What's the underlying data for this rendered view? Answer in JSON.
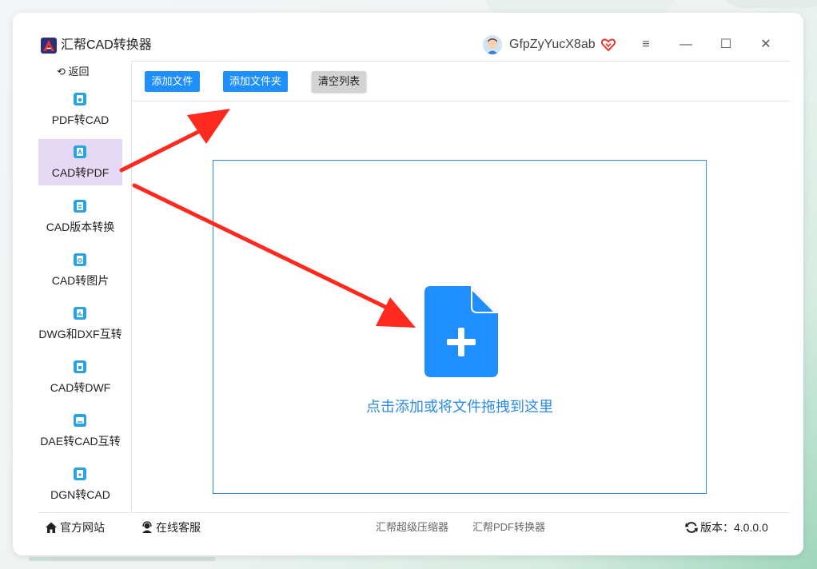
{
  "app": {
    "title": "汇帮CAD转换器"
  },
  "user": {
    "name": "GfpZyYucX8ab"
  },
  "window_controls": {
    "menu": "≡",
    "minimize": "—",
    "maximize": "☐",
    "close": "✕"
  },
  "sidebar": {
    "back_label": "返回",
    "items": [
      {
        "label": "PDF转CAD",
        "icon": "pdf-to-cad-icon",
        "active": false
      },
      {
        "label": "CAD转PDF",
        "icon": "cad-to-pdf-icon",
        "active": true
      },
      {
        "label": "CAD版本转换",
        "icon": "cad-version-icon",
        "active": false
      },
      {
        "label": "CAD转图片",
        "icon": "cad-to-image-icon",
        "active": false
      },
      {
        "label": "DWG和DXF互转",
        "icon": "dwg-dxf-icon",
        "active": false
      },
      {
        "label": "CAD转DWF",
        "icon": "cad-to-dwf-icon",
        "active": false
      },
      {
        "label": "DAE转CAD互转",
        "icon": "dae-cad-icon",
        "active": false
      },
      {
        "label": "DGN转CAD",
        "icon": "dgn-cad-icon",
        "active": false
      }
    ]
  },
  "toolbar": {
    "add_file": "添加文件",
    "add_folder": "添加文件夹",
    "clear_list": "清空列表"
  },
  "dropzone": {
    "hint": "点击添加或将文件拖拽到这里"
  },
  "footer": {
    "website": "官方网站",
    "support": "在线客服",
    "link1": "汇帮超级压缩器",
    "link2": "汇帮PDF转换器",
    "version": "版本：4.0.0.0"
  },
  "colors": {
    "accent": "#1f8fff",
    "active_nav": "#e6d9f6",
    "arrow": "#ff2a1f",
    "brand_logo": "#2b2f7a"
  }
}
